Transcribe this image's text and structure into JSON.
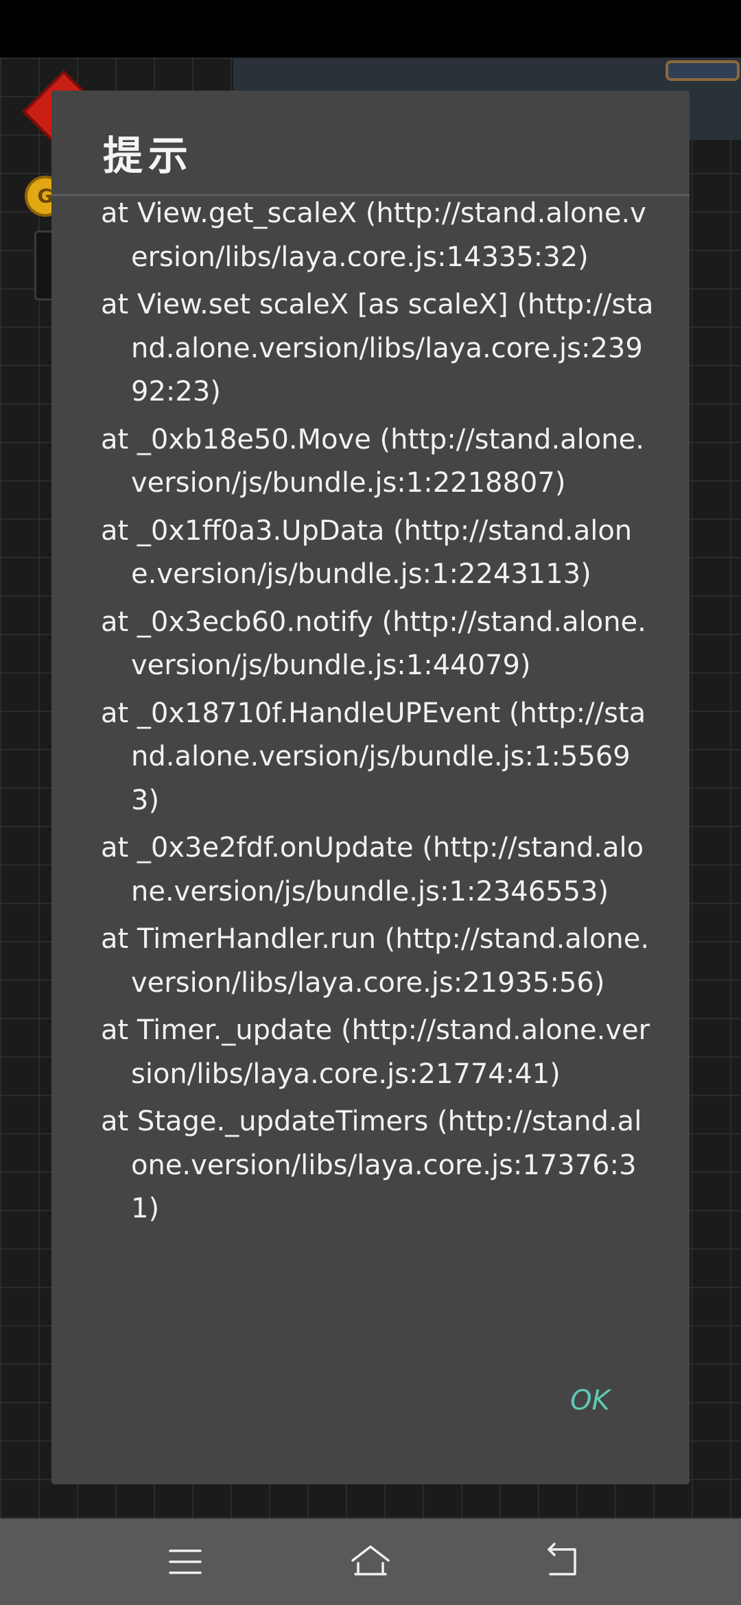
{
  "dialog": {
    "title": "提示",
    "message_lines": [
      "at View.get_scaleX (http://stand.alone.version/libs/laya.core.js:14335:32)",
      "at View.set scaleX [as scaleX] (http://stand.alone.version/libs/laya.core.js:23992:23)",
      "at _0xb18e50.Move (http://stand.alone.version/js/bundle.js:1:2218807)",
      "at _0x1ff0a3.UpData (http://stand.alone.version/js/bundle.js:1:2243113)",
      "at _0x3ecb60.notify (http://stand.alone.version/js/bundle.js:1:44079)",
      "at _0x18710f.HandleUPEvent (http://stand.alone.version/js/bundle.js:1:55693)",
      "at _0x3e2fdf.onUpdate (http://stand.alone.version/js/bundle.js:1:2346553)",
      "at TimerHandler.run (http://stand.alone.version/libs/laya.core.js:21935:56)",
      "at Timer._update (http://stand.alone.version/libs/laya.core.js:21774:41)",
      "at Stage._updateTimers (http://stand.alone.version/libs/laya.core.js:17376:31)"
    ],
    "ok_label": "OK"
  },
  "background": {
    "coin_letter": "G"
  },
  "nav_bar": {
    "buttons": [
      {
        "name": "menu",
        "icon": "menu-icon"
      },
      {
        "name": "home",
        "icon": "home-icon"
      },
      {
        "name": "back",
        "icon": "back-icon"
      }
    ]
  }
}
